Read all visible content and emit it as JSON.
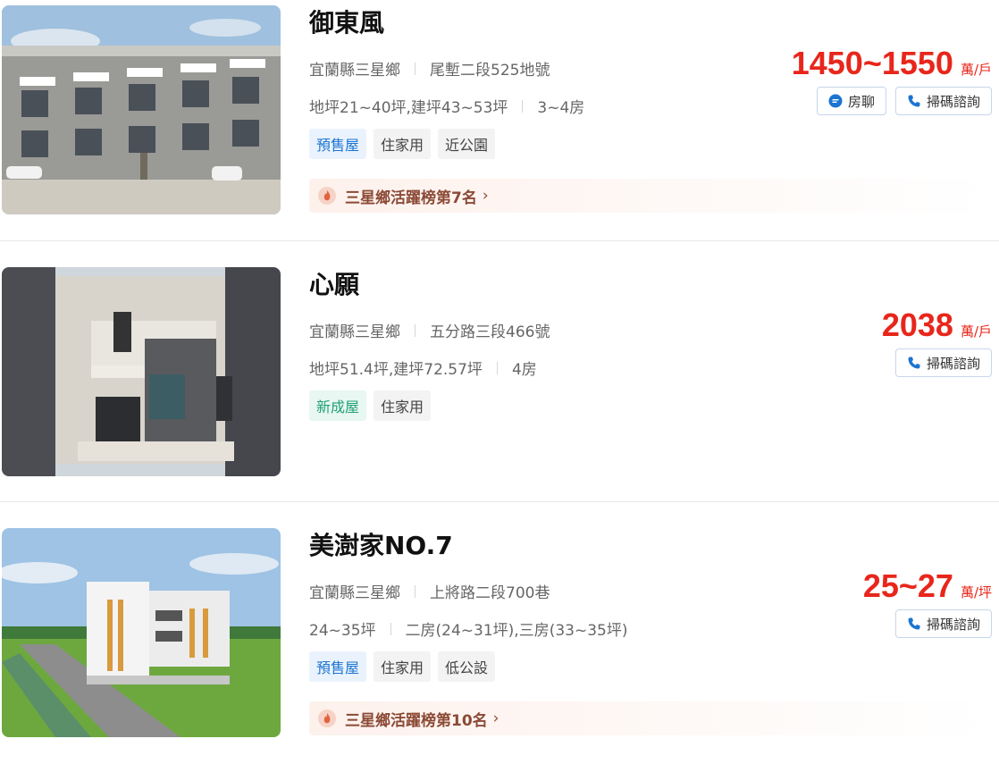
{
  "listings": [
    {
      "title": "御東風",
      "location": "宜蘭縣三星鄉",
      "address": "尾塹二段525地號",
      "sizes": "地坪21~40坪,建坪43~53坪",
      "rooms": "3~4房",
      "tags": [
        "預售屋",
        "住家用",
        "近公園"
      ],
      "rank": "三星鄉活躍榜第7名",
      "price": "1450~1550",
      "price_unit": "萬/戶",
      "chat_label": "房聊",
      "consult_label": "掃碼諮詢"
    },
    {
      "title": "心願",
      "location": "宜蘭縣三星鄉",
      "address": "五分路三段466號",
      "sizes": "地坪51.4坪,建坪72.57坪",
      "rooms": "4房",
      "tags": [
        "新成屋",
        "住家用"
      ],
      "price": "2038",
      "price_unit": "萬/戶",
      "consult_label": "掃碼諮詢"
    },
    {
      "title": "美澍家NO.7",
      "location": "宜蘭縣三星鄉",
      "address": "上將路二段700巷",
      "sizes": "24~35坪",
      "rooms": "二房(24~31坪),三房(33~35坪)",
      "tags": [
        "預售屋",
        "住家用",
        "低公設"
      ],
      "rank": "三星鄉活躍榜第10名",
      "price": "25~27",
      "price_unit": "萬/坪",
      "consult_label": "掃碼諮詢"
    }
  ],
  "colors": {
    "price": "#e8261b",
    "tag_blue": "#1c74d1",
    "tag_green": "#21a078",
    "rank_text": "#8b4a36"
  },
  "icons": {
    "chat": "chat-bubble-icon",
    "phone": "phone-icon",
    "rank": "flame-icon",
    "chevron": "chevron-right-icon"
  }
}
